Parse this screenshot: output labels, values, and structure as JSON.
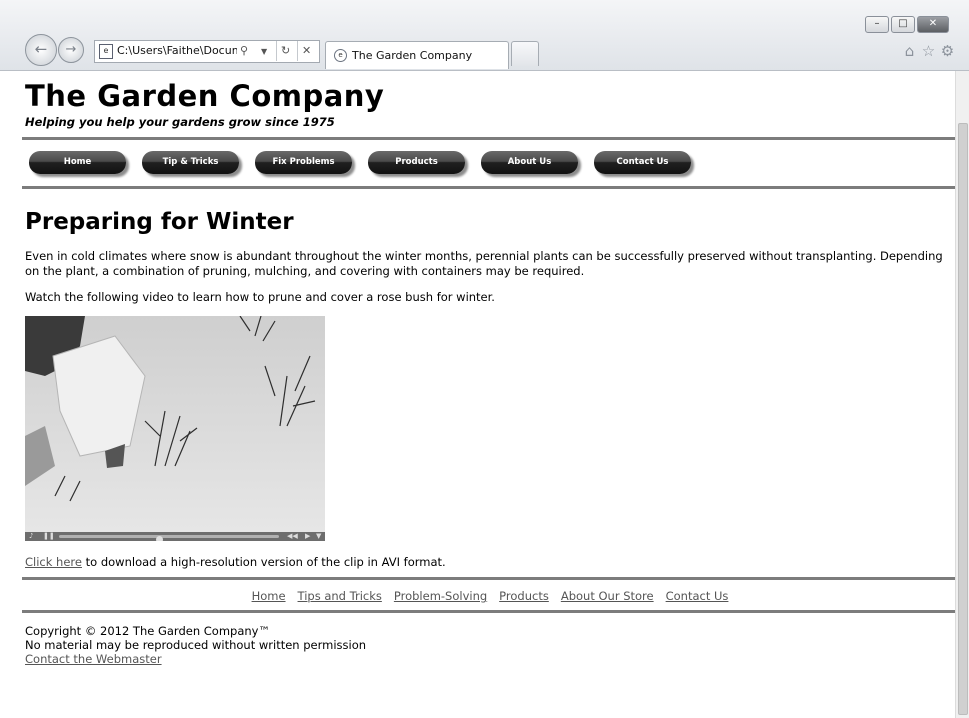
{
  "browser": {
    "address": "C:\\Users\\Faithe\\Docum",
    "tab_title": "The Garden Company",
    "window_controls": [
      "–",
      "□",
      "✕"
    ],
    "icons": [
      "back-icon",
      "forward-icon",
      "page-icon",
      "search-icon",
      "dropdown-icon",
      "refresh-icon",
      "stop-icon",
      "home-icon",
      "favorites-icon",
      "settings-icon"
    ]
  },
  "site": {
    "title": "The Garden Company",
    "tagline": "Helping you help your gardens grow since 1975"
  },
  "menu": [
    "Home",
    "Tip & Tricks",
    "Fix Problems",
    "Products",
    "About Us",
    "Contact Us"
  ],
  "main": {
    "heading": "Preparing for Winter",
    "paragraph1": "Even in cold climates where snow is abundant throughout the winter months, perennial plants can be successfully preserved without transplanting. Depending on the plant, a combination of pruning, mulching, and covering with containers may be required.",
    "paragraph2": "Watch the following video to learn how to prune and cover a rose bush for winter.",
    "download_link": "Click here",
    "download_text": " to download a high-resolution version of the clip in AVI format."
  },
  "footer": {
    "links": [
      "Home",
      "Tips and Tricks",
      "Problem-Solving",
      "Products",
      "About Our Store",
      "Contact Us"
    ],
    "copyright": "Copyright © 2012 The Garden Company™",
    "notice": "No material may be reproduced without written permission",
    "webmaster": "Contact the Webmaster"
  }
}
